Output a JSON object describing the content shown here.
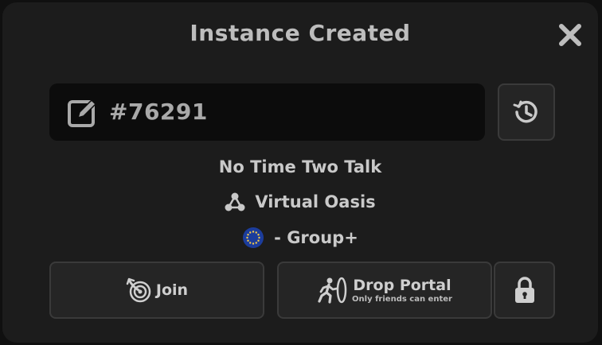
{
  "dialog": {
    "title": "Instance Created",
    "close_icon": "close-icon"
  },
  "instance": {
    "id": "#76291",
    "edit_icon": "edit-icon",
    "history_icon": "history-icon"
  },
  "info": {
    "name": "No Time Two Talk",
    "world": "Virtual Oasis",
    "world_icon": "network-icon",
    "region_icon": "eu-flag-icon",
    "access": "- Group+"
  },
  "actions": {
    "join_label": "Join",
    "join_icon": "join-icon",
    "portal_label": "Drop Portal",
    "portal_sub": "Only friends can enter",
    "portal_icon": "portal-icon",
    "lock_icon": "lock-icon"
  },
  "colors": {
    "dialog_bg": "#1c1c1c",
    "button_bg": "#252525",
    "field_bg": "#0c0c0c",
    "eu_blue": "#1c3d9c",
    "eu_star": "#f2c94c"
  }
}
